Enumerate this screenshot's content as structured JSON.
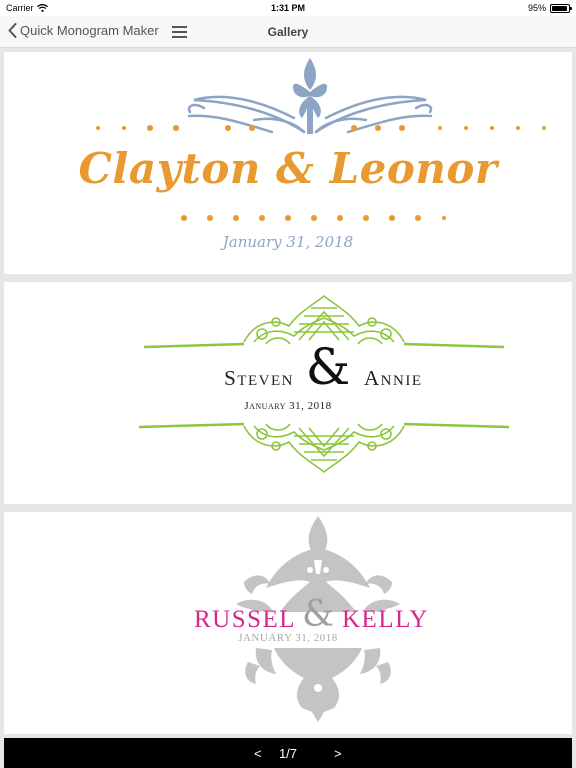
{
  "status": {
    "carrier": "Carrier",
    "time": "1:31 PM",
    "battery_text": "95%",
    "battery_level": 0.95
  },
  "navbar": {
    "back_label": "Quick Monogram Maker",
    "title": "Gallery"
  },
  "gallery": [
    {
      "names": "Clayton & Leonor",
      "date": "January 31, 2018",
      "accent": "#e89a30",
      "ornament": "#8ea4c4"
    },
    {
      "name_left": "Steven",
      "ampersand": "&",
      "name_right": "Annie",
      "date": "January 31, 2018",
      "accent": "#222222",
      "ornament": "#8cc63f"
    },
    {
      "name_left": "RUSSEL",
      "ampersand": "&",
      "name_right": "KELLY",
      "date": "JANUARY 31, 2018",
      "accent": "#d6278a",
      "ornament": "#b5b5b5"
    }
  ],
  "pager": {
    "prev": "<",
    "count": "1/7",
    "next": ">"
  },
  "icons": {
    "back": "chevron-left-icon",
    "menu": "hamburger-menu-icon",
    "wifi": "wifi-icon",
    "battery": "battery-icon"
  }
}
